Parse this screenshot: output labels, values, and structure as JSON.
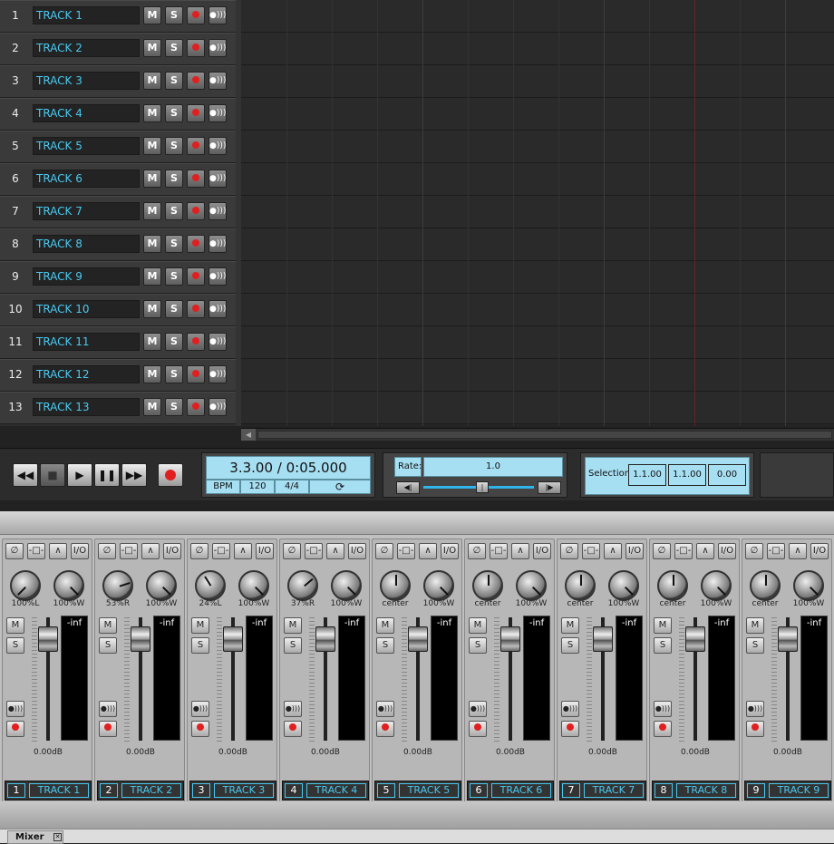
{
  "tracks": [
    {
      "num": "1",
      "name": "TRACK 1"
    },
    {
      "num": "2",
      "name": "TRACK 2"
    },
    {
      "num": "3",
      "name": "TRACK 3"
    },
    {
      "num": "4",
      "name": "TRACK 4"
    },
    {
      "num": "5",
      "name": "TRACK 5"
    },
    {
      "num": "6",
      "name": "TRACK 6"
    },
    {
      "num": "7",
      "name": "TRACK 7"
    },
    {
      "num": "8",
      "name": "TRACK 8"
    },
    {
      "num": "9",
      "name": "TRACK 9"
    },
    {
      "num": "10",
      "name": "TRACK 10"
    },
    {
      "num": "11",
      "name": "TRACK 11"
    },
    {
      "num": "12",
      "name": "TRACK 12"
    },
    {
      "num": "13",
      "name": "TRACK 13"
    }
  ],
  "track_buttons": {
    "mute": "M",
    "solo": "S"
  },
  "transport": {
    "buttons": [
      "rewind-icon",
      "stop-icon",
      "play-icon",
      "pause-icon",
      "fast-forward-icon",
      "record-icon"
    ],
    "time": "3.3.00 / 0:05.000",
    "bpm_label": "BPM",
    "bpm": "120",
    "time_sig": "4/4",
    "loop_icon": "loop-icon",
    "rate_label": "Rate:",
    "rate": "1.0",
    "selection_label": "Selection:",
    "selection_start": "1.1.00",
    "selection_end": "1.1.00",
    "selection_length": "0.00"
  },
  "mixer": {
    "io_label": "I/O",
    "mute": "M",
    "solo": "S",
    "channels": [
      {
        "num": "1",
        "name": "TRACK 1",
        "pan": "100%L",
        "width": "100%W",
        "meter": "-inf",
        "vol": "0.00dB"
      },
      {
        "num": "2",
        "name": "TRACK 2",
        "pan": "53%R",
        "width": "100%W",
        "meter": "-inf",
        "vol": "0.00dB"
      },
      {
        "num": "3",
        "name": "TRACK 3",
        "pan": "24%L",
        "width": "100%W",
        "meter": "-inf",
        "vol": "0.00dB"
      },
      {
        "num": "4",
        "name": "TRACK 4",
        "pan": "37%R",
        "width": "100%W",
        "meter": "-inf",
        "vol": "0.00dB"
      },
      {
        "num": "5",
        "name": "TRACK 5",
        "pan": "center",
        "width": "100%W",
        "meter": "-inf",
        "vol": "0.00dB"
      },
      {
        "num": "6",
        "name": "TRACK 6",
        "pan": "center",
        "width": "100%W",
        "meter": "-inf",
        "vol": "0.00dB"
      },
      {
        "num": "7",
        "name": "TRACK 7",
        "pan": "center",
        "width": "100%W",
        "meter": "-inf",
        "vol": "0.00dB"
      },
      {
        "num": "8",
        "name": "TRACK 8",
        "pan": "center",
        "width": "100%W",
        "meter": "-inf",
        "vol": "0.00dB"
      },
      {
        "num": "9",
        "name": "TRACK 9",
        "pan": "center",
        "width": "100%W",
        "meter": "-inf",
        "vol": "0.00dB"
      }
    ]
  },
  "tab": {
    "label": "Mixer"
  }
}
